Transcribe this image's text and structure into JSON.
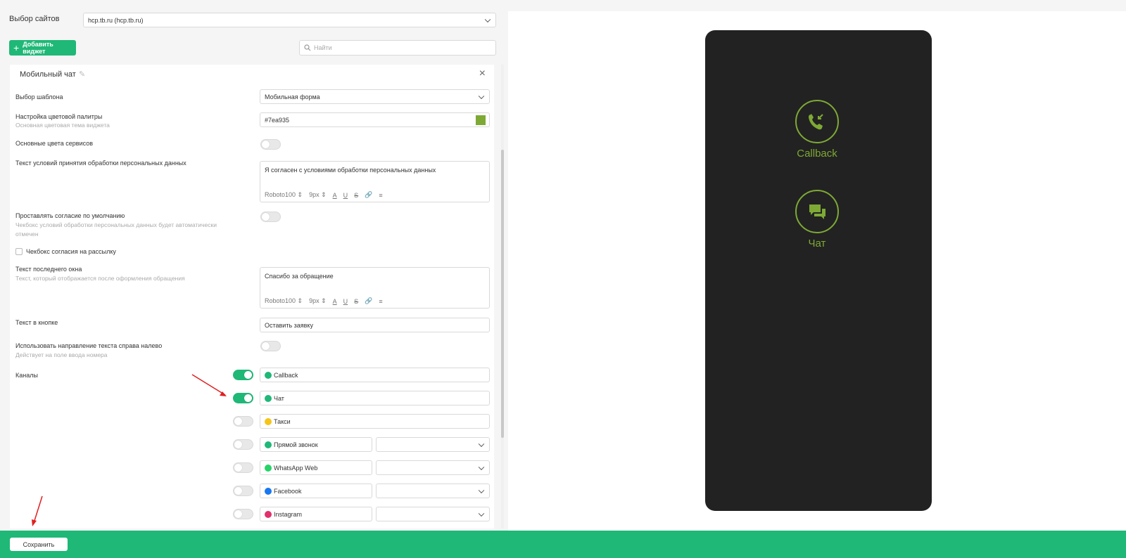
{
  "header": {
    "site_label": "Выбор сайтов",
    "site_value": "hcp.tb.ru (hcp.tb.ru)",
    "add_widget": "Добавить виджет",
    "search_placeholder": "Найти"
  },
  "widget": {
    "title": "Мобильный чат",
    "template_label": "Выбор шаблона",
    "template_value": "Мобильная форма",
    "palette_label": "Настройка цветовой палитры",
    "palette_sub": "Основная цветовая тема виджета",
    "palette_value": "#7ea935",
    "service_colors_label": "Основные цвета сервисов",
    "consent_text_label": "Текст условий принятия обработки персональных данных",
    "consent_text_value": "Я согласен с условиями обработки персональных данных",
    "consent_default_label": "Проставлять согласие по умолчанию",
    "consent_default_sub": "Чекбокс условий обработки персональных данных будет автоматически отмечен",
    "newsletter_checkbox_label": "Чекбокс согласия на рассылку",
    "last_window_label": "Текст последнего окна",
    "last_window_sub": "Текст, который отображается после оформления обращения",
    "last_window_value": "Спасибо за обращение",
    "button_text_label": "Текст в кнопке",
    "button_text_value": "Оставить заявку",
    "rtl_label": "Использовать направление текста справа налево",
    "rtl_sub": "Действует на поле ввода номера",
    "channels_label": "Каналы",
    "toolbar": {
      "font": "Roboto100",
      "size": "9px",
      "a": "A",
      "u": "U",
      "s": "S"
    }
  },
  "channels": [
    {
      "name": "Callback",
      "enabled": true,
      "icon": "callback-icon",
      "color": "#1fb877"
    },
    {
      "name": "Чат",
      "enabled": true,
      "icon": "chat-icon",
      "color": "#1fb877"
    },
    {
      "name": "Такси",
      "enabled": false,
      "icon": "taxi-icon",
      "color": "#f5c518"
    },
    {
      "name": "Прямой звонок",
      "enabled": false,
      "icon": "direct-call-icon",
      "color": "#1fb877"
    },
    {
      "name": "WhatsApp Web",
      "enabled": false,
      "icon": "whatsapp-icon",
      "color": "#25d366"
    },
    {
      "name": "Facebook",
      "enabled": false,
      "icon": "facebook-icon",
      "color": "#1877f2"
    },
    {
      "name": "Instagram",
      "enabled": false,
      "icon": "instagram-icon",
      "color": "#e1306c"
    }
  ],
  "footer": {
    "save": "Сохранить"
  },
  "preview": {
    "callback_label": "Callback",
    "chat_label": "Чат",
    "accent": "#7ea935"
  }
}
